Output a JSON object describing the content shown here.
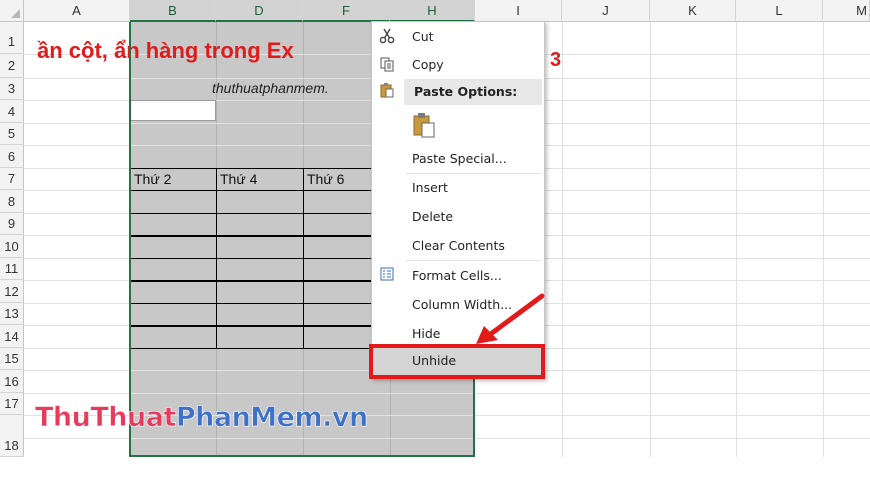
{
  "spreadsheet": {
    "columns": [
      "A",
      "B",
      "D",
      "F",
      "H",
      "I",
      "J",
      "K",
      "L",
      "M"
    ],
    "rows": [
      "1",
      "2",
      "3",
      "4",
      "5",
      "6",
      "7",
      "8",
      "9",
      "10",
      "11",
      "12",
      "13",
      "14",
      "15",
      "16",
      "17",
      "18"
    ],
    "title_text": "ần cột, ẩn hàng trong Ex",
    "title_suffix": "3",
    "subtitle_text": "thuthuatphanmem.",
    "table_headers": [
      "Thứ 2",
      "Thứ 4",
      "Thứ 6"
    ]
  },
  "context_menu": {
    "items": [
      {
        "label": "Cut",
        "icon": "scissors-icon"
      },
      {
        "label": "Copy",
        "icon": "copy-icon"
      },
      {
        "label": "Paste Options:",
        "icon": "paste-icon"
      },
      {
        "label": "Paste Special..."
      },
      {
        "label": "Insert"
      },
      {
        "label": "Delete"
      },
      {
        "label": "Clear Contents"
      },
      {
        "label": "Format Cells...",
        "icon": "format-cells-icon"
      },
      {
        "label": "Column Width..."
      },
      {
        "label": "Hide"
      },
      {
        "label": "Unhide"
      }
    ],
    "highlighted_item": "Unhide",
    "highlight_color": "#e21a1a"
  },
  "watermark": {
    "part1": "ThuThuat",
    "part2": "PhanMem",
    "part3": ".vn"
  },
  "colors": {
    "accent_green": "#217346",
    "title_red": "#e01b1b",
    "watermark_pink": "#e83a5c",
    "watermark_blue": "#3d70c8"
  }
}
